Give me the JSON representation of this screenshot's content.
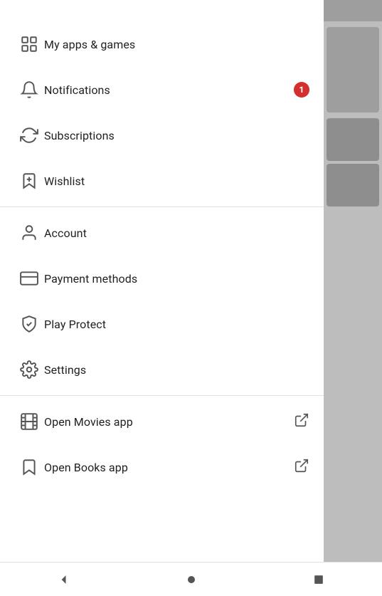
{
  "header": {
    "top_bg": "Google Play Store header"
  },
  "menu": {
    "items": [
      {
        "id": "my-apps-games",
        "label": "My apps & games",
        "icon": "grid-icon",
        "badge": null,
        "external": false
      },
      {
        "id": "notifications",
        "label": "Notifications",
        "icon": "bell-icon",
        "badge": "1",
        "external": false
      },
      {
        "id": "subscriptions",
        "label": "Subscriptions",
        "icon": "refresh-icon",
        "badge": null,
        "external": false
      },
      {
        "id": "wishlist",
        "label": "Wishlist",
        "icon": "bookmark-add-icon",
        "badge": null,
        "external": false
      }
    ],
    "items2": [
      {
        "id": "account",
        "label": "Account",
        "icon": "person-icon",
        "badge": null,
        "external": false
      },
      {
        "id": "payment-methods",
        "label": "Payment methods",
        "icon": "credit-card-icon",
        "badge": null,
        "external": false
      },
      {
        "id": "play-protect",
        "label": "Play Protect",
        "icon": "shield-icon",
        "badge": null,
        "external": false
      },
      {
        "id": "settings",
        "label": "Settings",
        "icon": "gear-icon",
        "badge": null,
        "external": false
      }
    ],
    "items3": [
      {
        "id": "open-movies",
        "label": "Open Movies app",
        "icon": "film-icon",
        "badge": null,
        "external": true
      },
      {
        "id": "open-books",
        "label": "Open Books app",
        "icon": "bookmark-icon",
        "badge": null,
        "external": true
      }
    ]
  },
  "bottom_nav": {
    "back_label": "back",
    "home_label": "home",
    "recents_label": "recents"
  }
}
